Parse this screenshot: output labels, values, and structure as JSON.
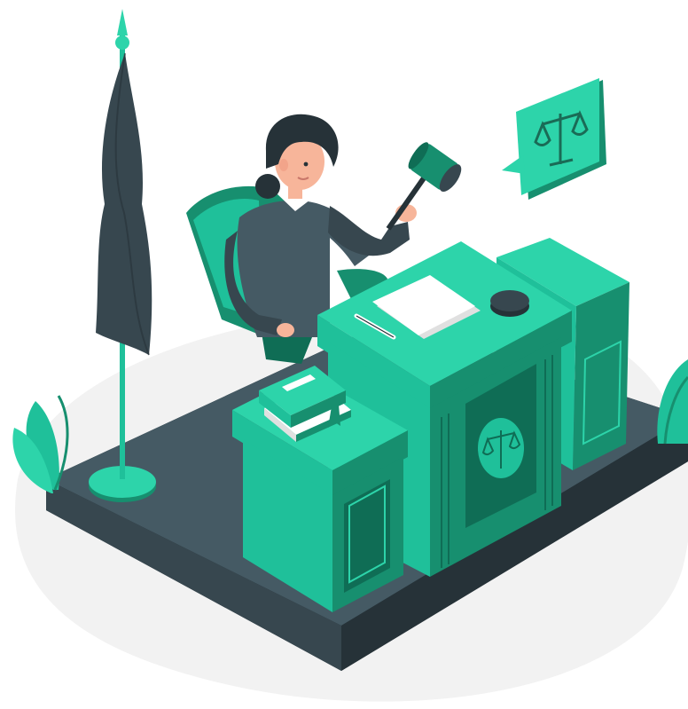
{
  "scene": {
    "description_visible_text": [],
    "colors": {
      "primary": "#1fc09a",
      "primary_light": "#2dd4aa",
      "primary_dark": "#178f6f",
      "primary_darker": "#0f6d55",
      "slate": "#37474f",
      "slate_dark": "#263238",
      "slate_mid": "#455a64",
      "backdrop": "#f2f2f2",
      "skin": "#f7b59a",
      "white": "#ffffff"
    },
    "icons": [
      "flag-icon",
      "gavel-icon",
      "scales-of-justice-icon",
      "speech-bubble-icon",
      "law-book-icon",
      "plant-icon"
    ]
  }
}
